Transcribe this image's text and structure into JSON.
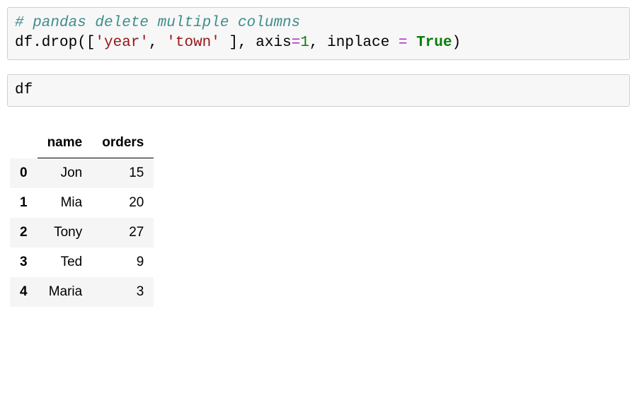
{
  "cells": {
    "cell1": {
      "comment": "# pandas delete multiple columns",
      "line2_pre": "df.drop([",
      "str1": "'year'",
      "sep1": ", ",
      "str2": "'town'",
      "after_list": " ], axis",
      "eq1": "=",
      "num1": "1",
      "sep2": ", inplace ",
      "eq2": "= ",
      "true_kw": "True",
      "close": ")"
    },
    "cell2": {
      "content": "df"
    }
  },
  "table": {
    "columns": [
      "name",
      "orders"
    ],
    "index": [
      "0",
      "1",
      "2",
      "3",
      "4"
    ],
    "rows": [
      {
        "name": "Jon",
        "orders": "15"
      },
      {
        "name": "Mia",
        "orders": "20"
      },
      {
        "name": "Tony",
        "orders": "27"
      },
      {
        "name": "Ted",
        "orders": "9"
      },
      {
        "name": "Maria",
        "orders": "3"
      }
    ]
  }
}
